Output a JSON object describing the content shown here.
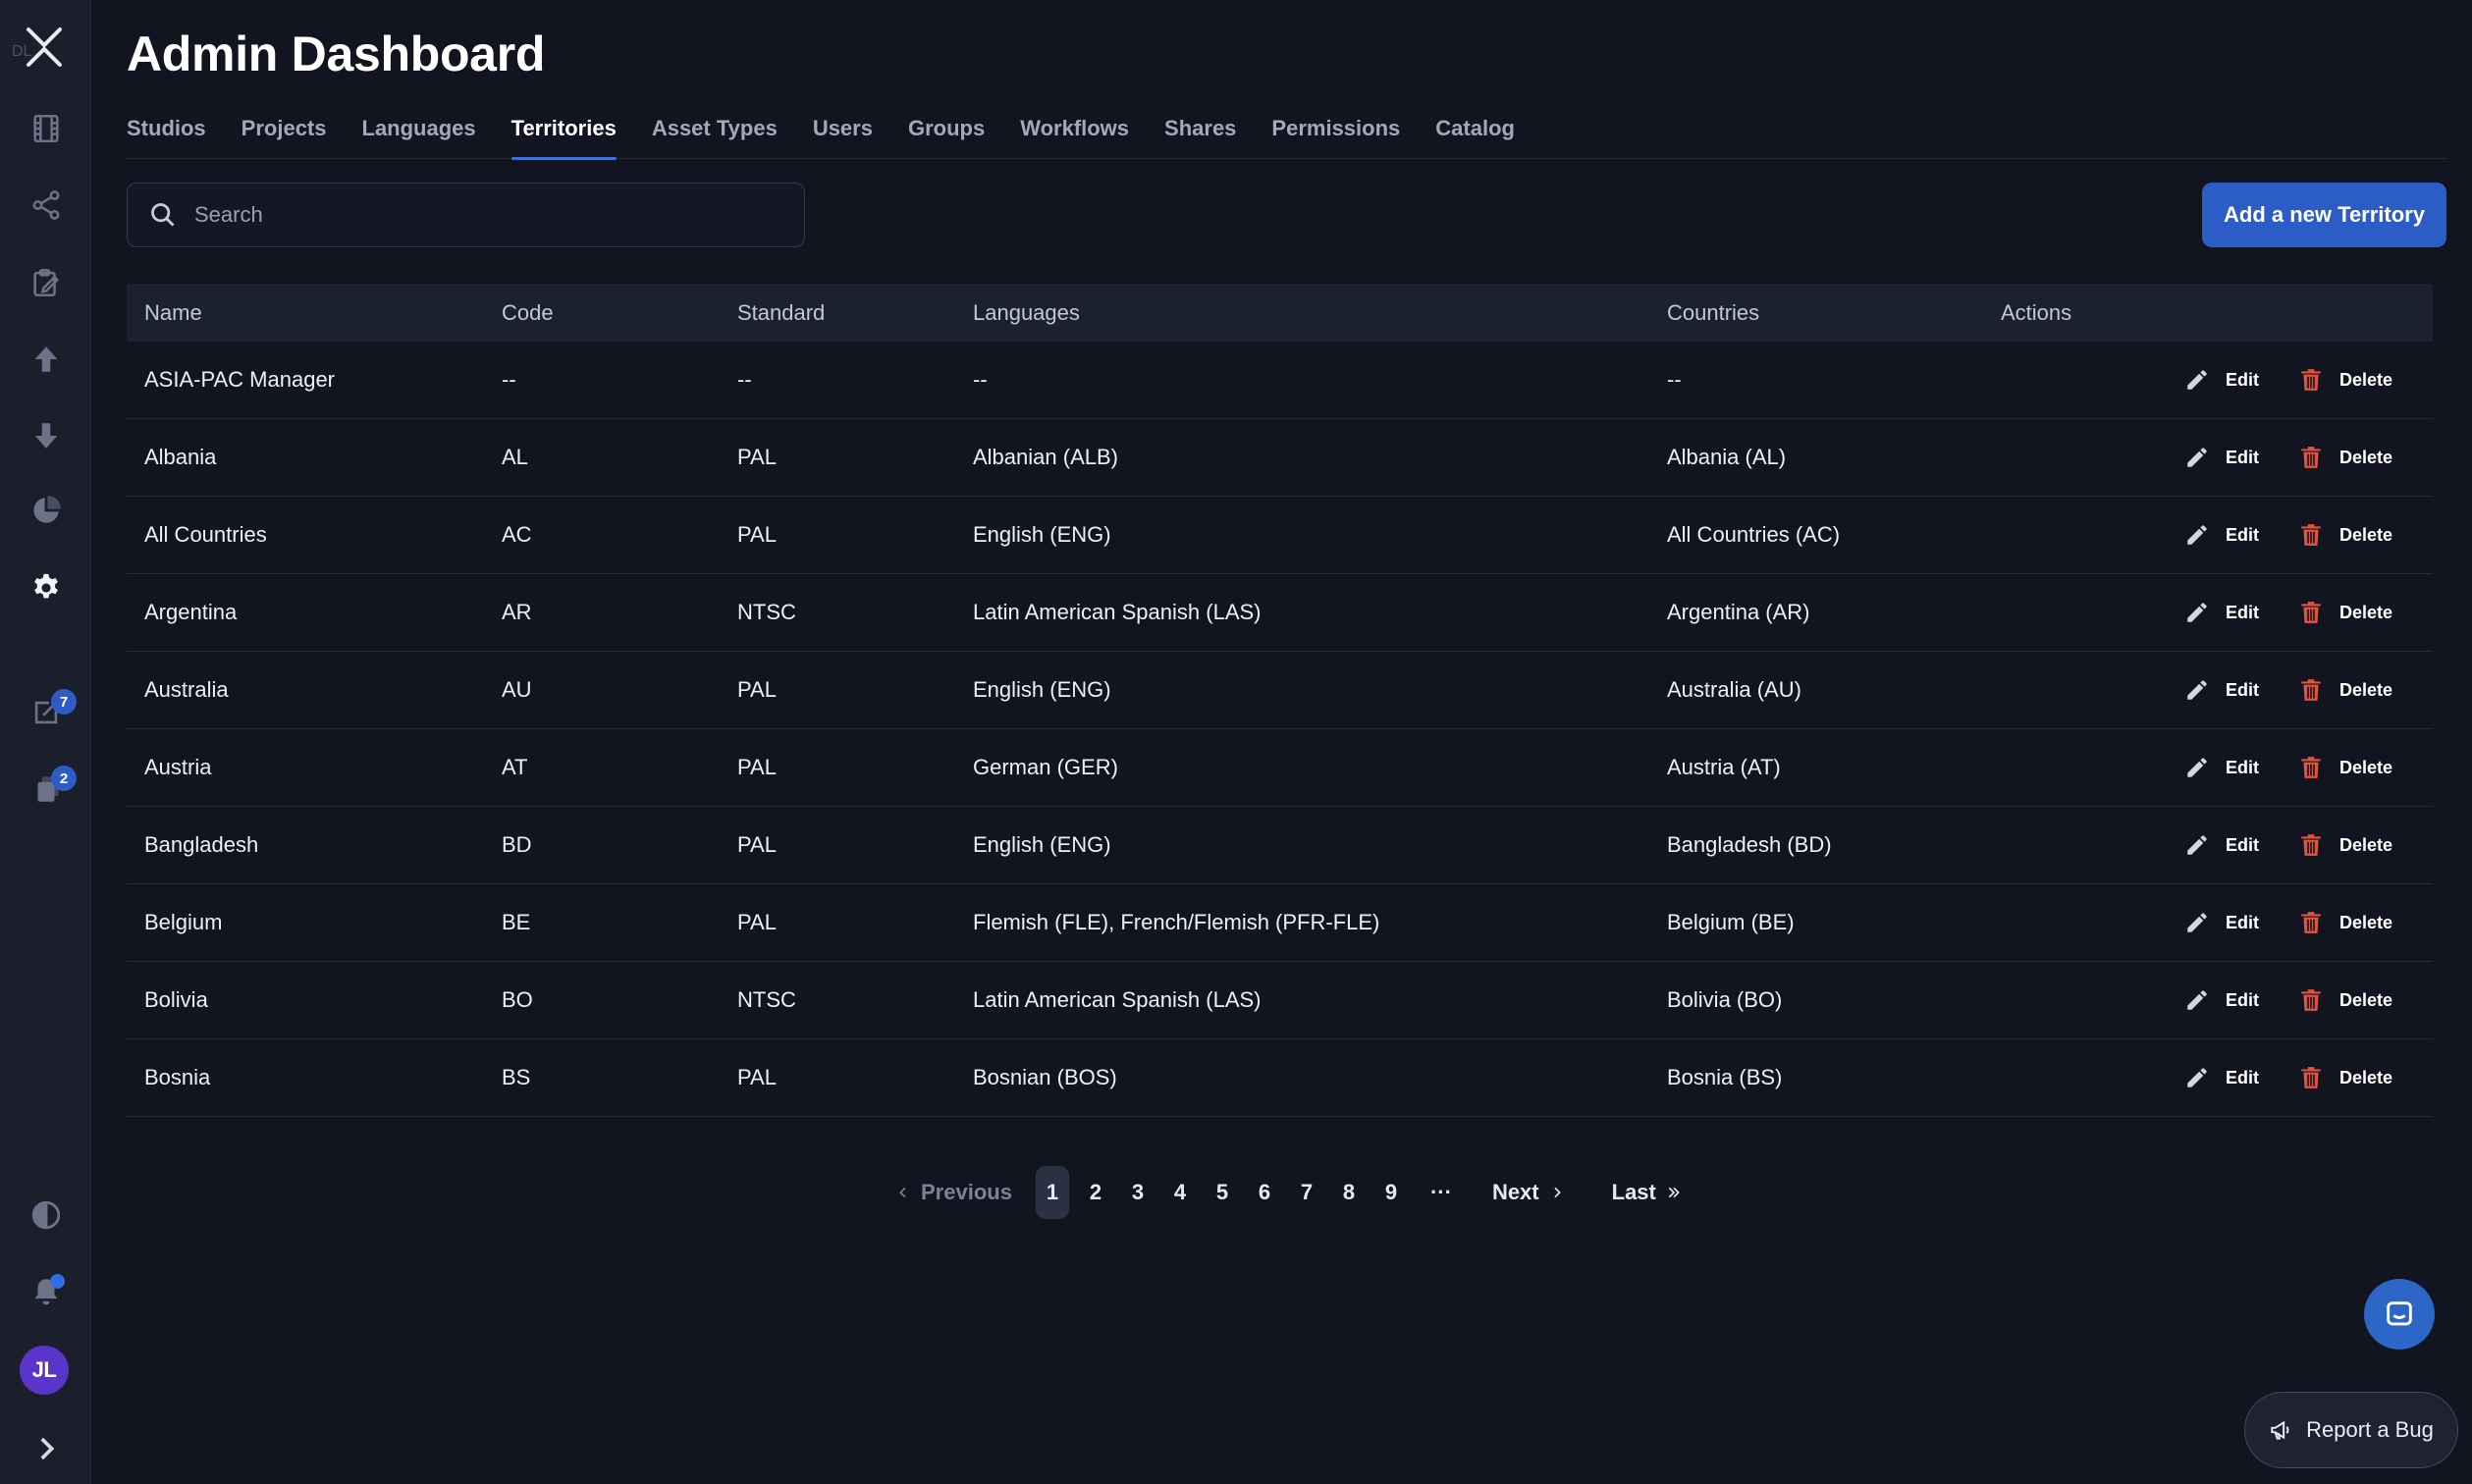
{
  "page": {
    "title": "Admin Dashboard"
  },
  "sidebar": {
    "logo_text": "DL",
    "badges": {
      "tasks": "7",
      "deliveries": "2"
    },
    "avatar_initials": "JL"
  },
  "tabs": [
    {
      "label": "Studios"
    },
    {
      "label": "Projects"
    },
    {
      "label": "Languages"
    },
    {
      "label": "Territories",
      "active": true
    },
    {
      "label": "Asset Types"
    },
    {
      "label": "Users"
    },
    {
      "label": "Groups"
    },
    {
      "label": "Workflows"
    },
    {
      "label": "Shares"
    },
    {
      "label": "Permissions"
    },
    {
      "label": "Catalog"
    }
  ],
  "search": {
    "placeholder": "Search",
    "value": ""
  },
  "toolbar": {
    "add_label": "Add a new Territory"
  },
  "table": {
    "columns": {
      "name": "Name",
      "code": "Code",
      "standard": "Standard",
      "languages": "Languages",
      "countries": "Countries",
      "actions": "Actions"
    },
    "edit_label": "Edit",
    "delete_label": "Delete",
    "rows": [
      {
        "name": "ASIA-PAC Manager",
        "code": "--",
        "standard": "--",
        "languages": "--",
        "countries": "--"
      },
      {
        "name": "Albania",
        "code": "AL",
        "standard": "PAL",
        "languages": "Albanian (ALB)",
        "countries": "Albania (AL)"
      },
      {
        "name": "All Countries",
        "code": "AC",
        "standard": "PAL",
        "languages": "English (ENG)",
        "countries": "All Countries (AC)"
      },
      {
        "name": "Argentina",
        "code": "AR",
        "standard": "NTSC",
        "languages": "Latin American Spanish (LAS)",
        "countries": "Argentina (AR)"
      },
      {
        "name": "Australia",
        "code": "AU",
        "standard": "PAL",
        "languages": "English (ENG)",
        "countries": "Australia (AU)"
      },
      {
        "name": "Austria",
        "code": "AT",
        "standard": "PAL",
        "languages": "German (GER)",
        "countries": "Austria (AT)"
      },
      {
        "name": "Bangladesh",
        "code": "BD",
        "standard": "PAL",
        "languages": "English (ENG)",
        "countries": "Bangladesh (BD)"
      },
      {
        "name": "Belgium",
        "code": "BE",
        "standard": "PAL",
        "languages": "Flemish (FLE), French/Flemish (PFR-FLE)",
        "countries": "Belgium (BE)"
      },
      {
        "name": "Bolivia",
        "code": "BO",
        "standard": "NTSC",
        "languages": "Latin American Spanish (LAS)",
        "countries": "Bolivia (BO)"
      },
      {
        "name": "Bosnia",
        "code": "BS",
        "standard": "PAL",
        "languages": "Bosnian (BOS)",
        "countries": "Bosnia (BS)"
      }
    ]
  },
  "pagination": {
    "previous_label": "Previous",
    "pages": [
      "1",
      "2",
      "3",
      "4",
      "5",
      "6",
      "7",
      "8",
      "9"
    ],
    "current": "1",
    "ellipsis": "···",
    "next_label": "Next",
    "last_label": "Last"
  },
  "floating": {
    "report_bug_label": "Report a Bug"
  },
  "colors": {
    "background": "#121520",
    "sidebar": "#1b1f2c",
    "accent": "#2c5cc5",
    "delete": "#e0533f",
    "avatar": "#5b34c9"
  }
}
